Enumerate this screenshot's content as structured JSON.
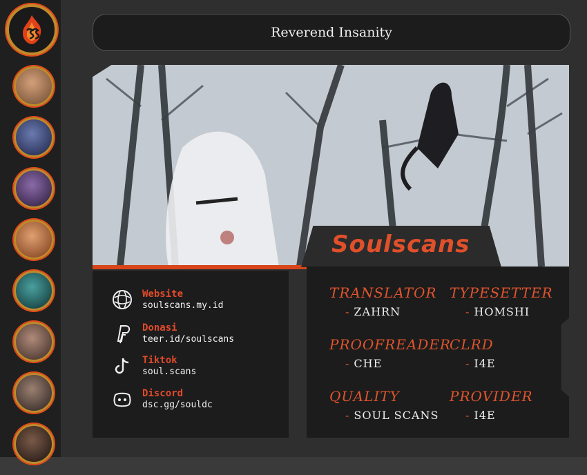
{
  "title": "Reverend Insanity",
  "brand": "Soulscans",
  "links": [
    {
      "label": "Website",
      "value": "soulscans.my.id",
      "icon": "globe-icon"
    },
    {
      "label": "Donasi",
      "value": "teer.id/soulscans",
      "icon": "paypal-icon"
    },
    {
      "label": "Tiktok",
      "value": "soul.scans",
      "icon": "tiktok-icon"
    },
    {
      "label": "Discord",
      "value": "dsc.gg/souldc",
      "icon": "discord-icon"
    }
  ],
  "credits": [
    {
      "role": "TRANSLATOR",
      "name": "ZAHRN"
    },
    {
      "role": "TYPESETTER",
      "name": "HOMSHI"
    },
    {
      "role": "PROOFREADER",
      "name": "CHE"
    },
    {
      "role": "CLRD",
      "name": "I4E"
    },
    {
      "role": "QUALITY",
      "name": "SOUL SCANS"
    },
    {
      "role": "PROVIDER",
      "name": "I4E"
    }
  ],
  "credit_dash": "-",
  "colors": {
    "accent": "#e0502a",
    "panel": "#1c1c1c",
    "background": "#2f2f2f",
    "ring": "#c08a2a"
  }
}
